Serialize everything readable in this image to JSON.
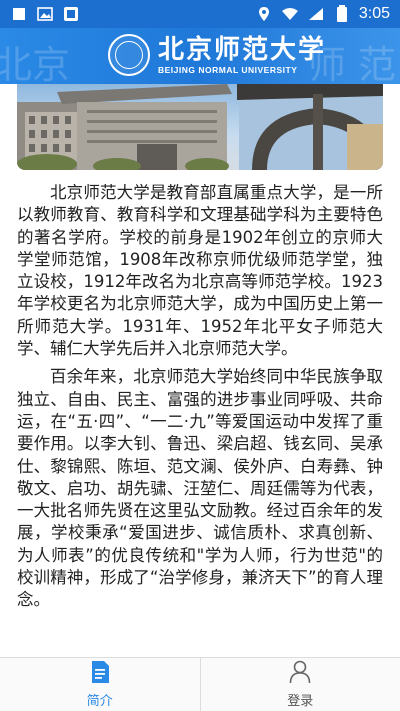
{
  "status_bar": {
    "time": "3:05",
    "battery_glyph": "⚡",
    "icons": [
      "square-icon",
      "image-icon",
      "app-icon",
      "location-icon",
      "wifi-icon",
      "signal-icon",
      "battery-icon"
    ]
  },
  "header": {
    "logo_cn": "北京师范大学",
    "logo_en": "BEIJING NORMAL UNIVERSITY",
    "decor_left": "北京",
    "decor_right": "师  范",
    "background_color": "#2b8ae6"
  },
  "article": {
    "paragraphs": [
      "北京师范大学是教育部直属重点大学，是一所以教师教育、教育科学和文理基础学科为主要特色的著名学府。学校的前身是1902年创立的京师大学堂师范馆，1908年改称京师优级师范学堂，独立设校，1912年改名为北京高等师范学校。1923年学校更名为北京师范大学，成为中国历史上第一所师范大学。1931年、1952年北平女子师范大学、辅仁大学先后并入北京师范大学。",
      "百余年来，北京师范大学始终同中华民族争取独立、自由、民主、富强的进步事业同呼吸、共命运，在“五·四”、“一二·九”等爱国运动中发挥了重要作用。以李大钊、鲁迅、梁启超、钱玄同、吴承仕、黎锦熙、陈垣、范文澜、侯外庐、白寿彝、钟敬文、启功、胡先骕、汪堃仁、周廷儒等为代表，一大批名师先贤在这里弘文励教。经过百余年的发展，学校秉承“爱国进步、诚信质朴、求真创新、为人师表”的优良传统和\"学为人师，行为世范\"的校训精神，形成了“治学修身，兼济天下”的育人理念。"
    ]
  },
  "bottom_nav": {
    "items": [
      {
        "label": "简介",
        "icon": "document-icon",
        "active": true
      },
      {
        "label": "登录",
        "icon": "person-icon",
        "active": false
      }
    ],
    "active_color": "#2b8ae6"
  }
}
